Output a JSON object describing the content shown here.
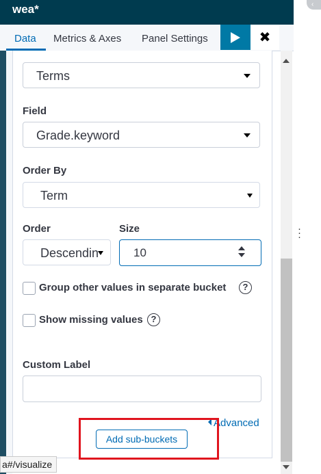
{
  "header": {
    "title": "wea*"
  },
  "tabs": [
    {
      "label": "Data",
      "active": true
    },
    {
      "label": "Metrics & Axes",
      "active": false
    },
    {
      "label": "Panel Settings",
      "active": false
    }
  ],
  "toolbar": {
    "run_icon": "play-icon",
    "close_icon": "close-icon",
    "close_glyph": "✖"
  },
  "aggregation": {
    "value": "Terms"
  },
  "field": {
    "label": "Field",
    "value": "Grade.keyword"
  },
  "order_by": {
    "label": "Order By",
    "value": "Term"
  },
  "order": {
    "label": "Order",
    "value": "Descending"
  },
  "size": {
    "label": "Size",
    "value": "10"
  },
  "options": {
    "group_other": {
      "label": "Group other values in separate bucket",
      "checked": false
    },
    "show_missing": {
      "label": "Show missing values",
      "checked": false
    }
  },
  "custom_label": {
    "label": "Custom Label",
    "value": ""
  },
  "advanced_link": {
    "label": "Advanced"
  },
  "add_sub_buckets": {
    "label": "Add sub-buckets"
  },
  "status_url": "a#/visualize",
  "colors": {
    "header_bg": "#003b4f",
    "accent": "#006bb4",
    "run_bg": "#0079a5",
    "highlight": "#e0141e"
  }
}
